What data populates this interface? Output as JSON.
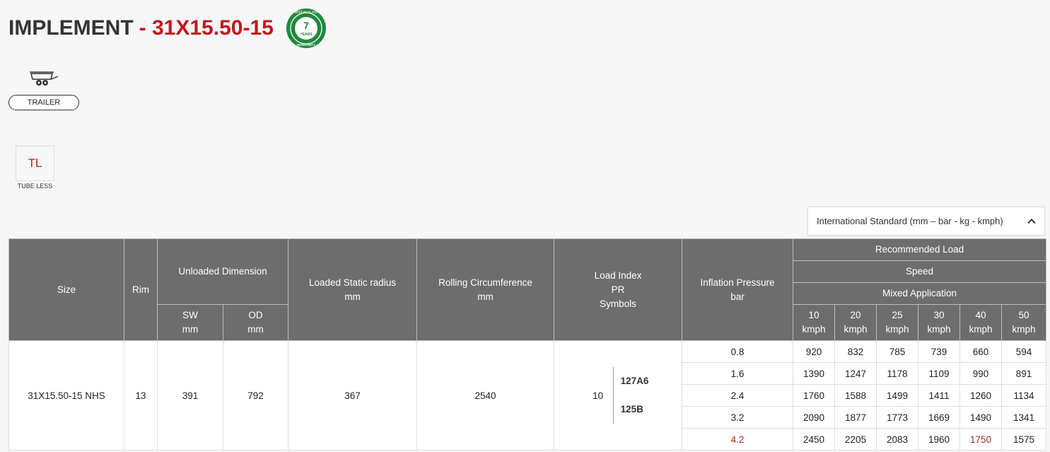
{
  "header": {
    "title": "IMPLEMENT",
    "size": "- 31X15.50-15",
    "badge": {
      "line1": "BEST IN CLASS",
      "number": "7",
      "years": "YEARS",
      "line2": "WARRANTY",
      "color": "#1f8a3c"
    }
  },
  "application": {
    "label": "TRAILER",
    "icon": "trailer-icon"
  },
  "construction": {
    "code": "TL",
    "label": "TUBE LESS"
  },
  "unit_select": {
    "value": "International Standard (mm – bar - kg - kmph)",
    "icon": "chevron-up-icon"
  },
  "table": {
    "headers": {
      "size": "Size",
      "rim": "Rim",
      "unloaded": "Unloaded Dimension",
      "sw": "SW",
      "od": "OD",
      "mm": "mm",
      "loaded_radius": "Loaded Static radius",
      "rolling": "Rolling Circumference",
      "load_index_1": "Load Index",
      "load_index_2": "PR",
      "load_index_3": "Symbols",
      "inflation": "Inflation Pressure",
      "bar": "bar",
      "recommended": "Recommended Load",
      "speed": "Speed",
      "mixed": "Mixed Application",
      "kmph": "kmph",
      "speeds": [
        "10",
        "20",
        "25",
        "30",
        "40",
        "50"
      ]
    },
    "row": {
      "size": "31X15.50-15 NHS",
      "rim": "13",
      "sw": "391",
      "od": "792",
      "loaded_radius": "367",
      "rolling": "2540",
      "pr": "10",
      "symbol1": "127A6",
      "symbol2": "125B"
    },
    "pressures": [
      {
        "bar": "0.8",
        "loads": [
          "920",
          "832",
          "785",
          "739",
          "660",
          "594"
        ]
      },
      {
        "bar": "1.6",
        "loads": [
          "1390",
          "1247",
          "1178",
          "1109",
          "990",
          "891"
        ]
      },
      {
        "bar": "2.4",
        "loads": [
          "1760",
          "1588",
          "1499",
          "1411",
          "1260",
          "1134"
        ]
      },
      {
        "bar": "3.2",
        "loads": [
          "2090",
          "1877",
          "1773",
          "1669",
          "1490",
          "1341"
        ]
      },
      {
        "bar": "4.2",
        "loads": [
          "2450",
          "2205",
          "2083",
          "1960",
          "1750",
          "1575"
        ]
      }
    ],
    "highlight_color": "#a52a2a"
  }
}
